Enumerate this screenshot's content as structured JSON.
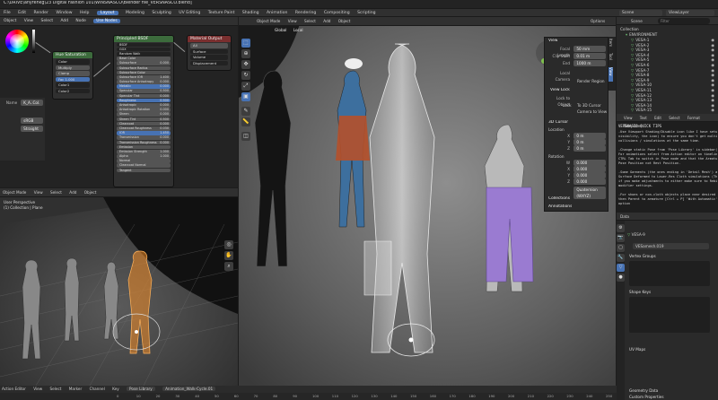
{
  "app": {
    "title": "C:\\DRIVE\\anyrenkg\\23 Digital Fashion 101\\WINSNASCO\\Blender file_VERSNASCO.blend]",
    "menus": [
      "File",
      "Edit",
      "Render",
      "Window",
      "Help"
    ],
    "workspaces": [
      "Layout",
      "Modeling",
      "Sculpting",
      "UV Editing",
      "Texture Paint",
      "Shading",
      "Animation",
      "Rendering",
      "Compositing",
      "Scripting"
    ],
    "active_workspace": "Layout",
    "scene_label": "Scene",
    "view_layer_label": "ViewLayer"
  },
  "node_editor": {
    "header": [
      "Object",
      "View",
      "Select",
      "Add",
      "Node"
    ],
    "use_nodes": "Use Nodes",
    "nodes": {
      "bsdf_title": "Principled BSDF",
      "bsdf_rows": [
        "BSDF",
        "GGX",
        "Random Walk",
        "Base Color",
        "Subsurface",
        "Subsurface Radius",
        "Subsurface Color",
        "Subsurface IOR",
        "Subsurface Anisotropy",
        "Metallic",
        "Specular",
        "Specular Tint",
        "Roughness",
        "Anisotropic",
        "Anisotropic Rotation",
        "Sheen",
        "Sheen Tint",
        "Clearcoat",
        "Clearcoat Roughness",
        "IOR",
        "Transmission",
        "Transmission Roughness",
        "Emission",
        "Emission Strength",
        "Alpha",
        "Normal",
        "Clearcoat Normal",
        "Tangent"
      ],
      "bsdf_values": [
        "",
        "",
        "",
        "",
        "0.000",
        "",
        "",
        "1.400",
        "0.000",
        "0.000",
        "0.500",
        "0.000",
        "0.500",
        "0.000",
        "0.000",
        "0.000",
        "0.500",
        "0.000",
        "0.030",
        "1.450",
        "0.000",
        "0.000",
        "",
        "1.000",
        "1.000",
        "",
        "",
        ""
      ],
      "output_title": "Material Output",
      "output_rows": [
        "All",
        "Surface",
        "Volume",
        "Displacement"
      ],
      "hsv_title": "Hue Saturation",
      "hsv_rows": [
        "Color",
        "Multiply",
        "Clamp",
        "Fac",
        "Color1",
        "Color2"
      ],
      "hsv_fac": "1.000"
    },
    "side_panel": {
      "title": "Properties",
      "rows": [
        [
          "Name",
          "K_A..Col."
        ],
        [
          "",
          ""
        ],
        [
          "",
          "sRGB"
        ],
        [
          "",
          "Straight"
        ]
      ]
    }
  },
  "main_viewport": {
    "header": [
      "Object Mode",
      "View",
      "Select",
      "Add",
      "Object"
    ],
    "transform": "Global",
    "pivot": "Local",
    "overlay_label": "Options",
    "user_persp": "User Perspective",
    "collection_label": "(0) Collection | VERSNASCO",
    "view_panel": {
      "title": "View",
      "focal_length_label": "Focal Length",
      "focal_length": "50 mm",
      "clip_start_label": "Clip Start",
      "clip_start": "0.01 m",
      "clip_end_label": "End",
      "clip_end": "1000 m",
      "local_camera_label": "Local Camera",
      "render_region": "Render Region",
      "view_lock_title": "View Lock",
      "lock_to_object": "Lock to Object",
      "lock_label": "Lock",
      "to_3d_cursor": "To 3D Cursor",
      "camera_to_view": "Camera to View",
      "cursor_title": "3D Cursor",
      "location_label": "Location",
      "cursor_x": "0 m",
      "cursor_y": "0 m",
      "cursor_z": "0 m",
      "rotation_label": "Rotation",
      "rot_w": "0.000",
      "rot_x": "0.000",
      "rot_y": "0.000",
      "rot_z": "0.000",
      "rotation_mode": "Quaternion (WXYZ)",
      "collections_title": "Collections",
      "annotations_title": "Annotations"
    },
    "side_tabs": [
      "Item",
      "Tool",
      "View"
    ]
  },
  "small_viewport": {
    "header": [
      "Object Mode",
      "View",
      "Select",
      "Add",
      "Object"
    ],
    "persp": "User Perspective",
    "collection": "(1) Collection | Plane"
  },
  "outliner": {
    "title": "Scene",
    "search_placeholder": "Filter",
    "root": "Collection",
    "group": "ENVIRONMENT",
    "items": [
      "VESA-1",
      "VESA-2",
      "VESA-3",
      "VESA-4",
      "VESA-5",
      "VESA-6",
      "VESA-7",
      "VESA-8",
      "VESA-9",
      "VESA-10",
      "VESA-11",
      "VESA-12",
      "VESA-13",
      "VESA-14",
      "VESA-15"
    ]
  },
  "text_editor": {
    "header": [
      "View",
      "Text",
      "Edit",
      "Select",
      "Format",
      "Templates"
    ],
    "title": "VERSNASCO QUICK TIPS",
    "lines": [
      "-Use Viewport Shading/Disable icon like I have setup",
      "visibility, the icon) to ensure you don't get multiple",
      "collisions / simulations at the same time.",
      "",
      "-Change static Pose from 'Pose Library' in sidebar(N)",
      "For animations select from Action editor on timeline",
      "CTRL Tab to switch in Pose mode and that the Armature",
      "Pose Position not Rest Position.",
      "",
      "-Some Garments (the ones ending in 'Detail Mesh') are",
      "Surface Deformed to Lower-Res Cloth simulations (The",
      "if you make adjustments to either make sure to Rebind",
      "modifier settings.",
      "",
      "-For shoes or non-cloth objects place near desired",
      "then Parent to armature [Ctrl + P] 'With Automatic'",
      "option"
    ]
  },
  "properties": {
    "header": "Data",
    "object_name": "VESA-9",
    "mesh_name": "VESamesh.019",
    "vertex_groups": "Vertex Groups",
    "shape_keys": "Shape Keys",
    "uv_maps": "UV Maps",
    "geometry_data": "Geometry Data",
    "custom_properties": "Custom Properties"
  },
  "timeline": {
    "editor": "Action Editor",
    "menus": [
      "View",
      "Select",
      "Marker",
      "Channel",
      "Key"
    ],
    "mode": "Pose Library",
    "action": "Animation_Walk-Cycle.01",
    "frame_labels": [
      "0",
      "10",
      "20",
      "30",
      "40",
      "50",
      "60",
      "70",
      "80",
      "90",
      "100",
      "110",
      "120",
      "130",
      "140",
      "150",
      "160",
      "170",
      "180",
      "190",
      "200",
      "210",
      "220",
      "230",
      "240",
      "250"
    ]
  },
  "colors": {
    "accent": "#4772b3",
    "outliner_icon": "#6fbf73",
    "bsdf_header": "#3c6b3c",
    "output_header": "#7a2f2f",
    "hsv_header": "#3c6b3c",
    "selection_orange": "#f08a24"
  }
}
